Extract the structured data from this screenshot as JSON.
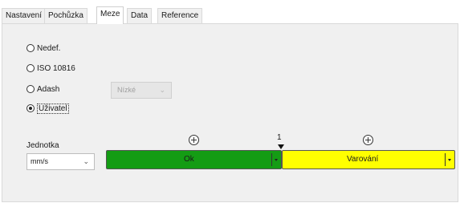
{
  "tabs": [
    {
      "label": "Nastavení",
      "active": false
    },
    {
      "label": "Pochůzka",
      "active": false
    },
    {
      "label": "Meze",
      "active": true
    },
    {
      "label": "Data",
      "active": false
    },
    {
      "label": "Reference",
      "active": false
    }
  ],
  "standard": {
    "options": [
      {
        "label": "Nedef.",
        "checked": false
      },
      {
        "label": "ISO 10816",
        "checked": false
      },
      {
        "label": "Adash",
        "checked": false
      },
      {
        "label": "Uživatel",
        "checked": true
      }
    ],
    "adash_level": {
      "value": "Nízké",
      "enabled": false
    }
  },
  "unit": {
    "label": "Jednotka",
    "value": "mm/s"
  },
  "limits": {
    "boundary_value": "1",
    "zones": [
      {
        "label": "Ok",
        "color": "#149c14"
      },
      {
        "label": "Varování",
        "color": "#ffff00"
      }
    ]
  },
  "icons": {
    "add": "plus-circle-icon",
    "marker": "triangle-down-icon",
    "dropdown": "chevron-down-icon"
  }
}
